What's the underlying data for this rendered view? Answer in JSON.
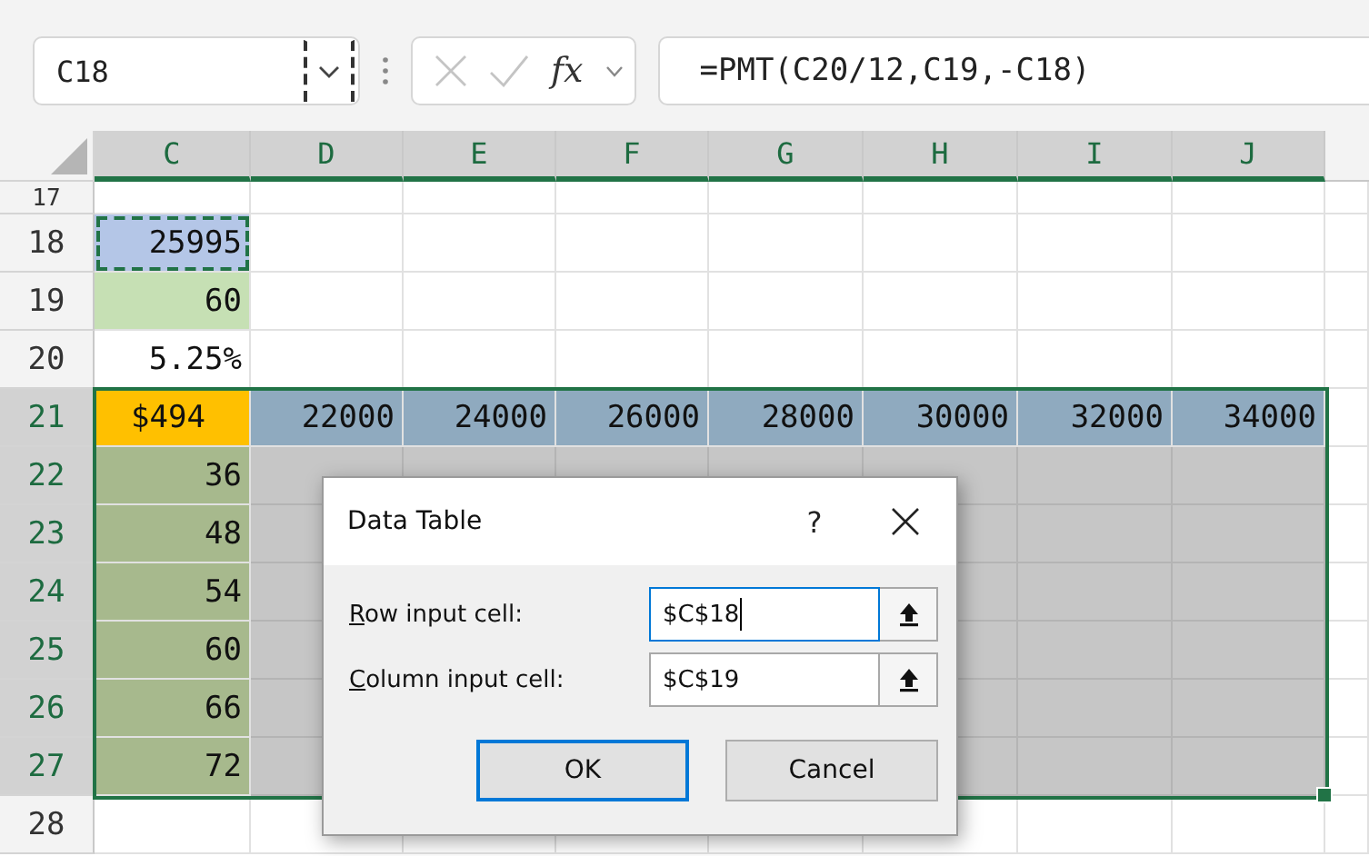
{
  "formula_bar": {
    "name_box": "C18",
    "fx": "fx",
    "formula": "=PMT(C20/12,C19,-C18)"
  },
  "columns": [
    {
      "label": "C",
      "selected": true
    },
    {
      "label": "D",
      "selected": true
    },
    {
      "label": "E",
      "selected": true
    },
    {
      "label": "F",
      "selected": true
    },
    {
      "label": "G",
      "selected": true
    },
    {
      "label": "H",
      "selected": true
    },
    {
      "label": "I",
      "selected": true
    },
    {
      "label": "J",
      "selected": true
    }
  ],
  "rows": [
    {
      "number": "17",
      "selected": false,
      "cells": []
    },
    {
      "number": "18",
      "selected": false,
      "cells": [
        {
          "text": "25995",
          "color": "#b4c6e7",
          "marquee": true
        }
      ]
    },
    {
      "number": "19",
      "selected": false,
      "cells": [
        {
          "text": "60",
          "color": "#c6e0b4"
        }
      ]
    },
    {
      "number": "20",
      "selected": false,
      "cells": [
        {
          "text": "5.25%"
        }
      ]
    },
    {
      "number": "21",
      "selected": true,
      "cells": [
        {
          "text": "$494",
          "color": "#ffc000",
          "kind": "currency"
        },
        {
          "text": "22000",
          "color": "#8faabf"
        },
        {
          "text": "24000",
          "color": "#8faabf"
        },
        {
          "text": "26000",
          "color": "#8faabf"
        },
        {
          "text": "28000",
          "color": "#8faabf"
        },
        {
          "text": "30000",
          "color": "#8faabf"
        },
        {
          "text": "32000",
          "color": "#8faabf"
        },
        {
          "text": "34000",
          "color": "#8faabf"
        }
      ]
    },
    {
      "number": "22",
      "selected": true,
      "cells": [
        {
          "text": "36",
          "color": "#a7b98d"
        }
      ]
    },
    {
      "number": "23",
      "selected": true,
      "cells": [
        {
          "text": "48",
          "color": "#a7b98d"
        }
      ]
    },
    {
      "number": "24",
      "selected": true,
      "cells": [
        {
          "text": "54",
          "color": "#a7b98d"
        }
      ]
    },
    {
      "number": "25",
      "selected": true,
      "cells": [
        {
          "text": "60",
          "color": "#a7b98d"
        }
      ]
    },
    {
      "number": "26",
      "selected": true,
      "cells": [
        {
          "text": "66",
          "color": "#a7b98d"
        }
      ]
    },
    {
      "number": "27",
      "selected": true,
      "cells": [
        {
          "text": "72",
          "color": "#a7b98d"
        }
      ]
    },
    {
      "number": "28",
      "selected": false,
      "cells": []
    }
  ],
  "dialog": {
    "title": "Data Table",
    "help": "?",
    "fields": [
      {
        "label": "Row input cell:",
        "value": "$C$18",
        "focused": true
      },
      {
        "label": "Column input cell:",
        "value": "$C$19",
        "focused": false
      }
    ],
    "buttons": [
      {
        "label": "OK",
        "default": true
      },
      {
        "label": "Cancel",
        "default": false
      }
    ]
  }
}
